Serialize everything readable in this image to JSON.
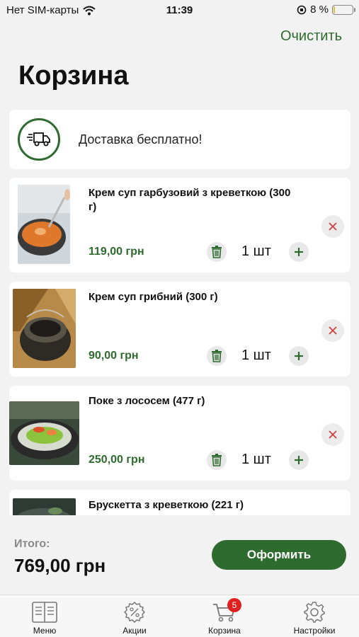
{
  "status_bar": {
    "carrier": "Нет SIM-карты",
    "time": "11:39",
    "battery": "8 %",
    "battery_level": 0.08
  },
  "header": {
    "clear_label": "Очистить",
    "title": "Корзина"
  },
  "delivery": {
    "text": "Доставка бесплатно!",
    "icon": "delivery-truck-icon"
  },
  "items": [
    {
      "name": "Крем суп гарбузовий з креветкою (300 г)",
      "price": "119,00 грн",
      "qty": "1 шт"
    },
    {
      "name": "Крем суп грибний (300 г)",
      "price": "90,00 грн",
      "qty": "1 шт"
    },
    {
      "name": "Поке з лососем (477 г)",
      "price": "250,00 грн",
      "qty": "1 шт"
    },
    {
      "name": "Брускетта з креветкою (221 г)",
      "price": "",
      "qty": ""
    }
  ],
  "footer": {
    "total_label": "Итого:",
    "total_value": "769,00 грн",
    "checkout_label": "Оформить"
  },
  "tabbar": {
    "tabs": [
      {
        "label": "Меню",
        "icon": "menu-book-icon"
      },
      {
        "label": "Акции",
        "icon": "discount-badge-icon"
      },
      {
        "label": "Корзина",
        "icon": "cart-icon",
        "badge": "5"
      },
      {
        "label": "Настройки",
        "icon": "gear-icon"
      }
    ]
  },
  "colors": {
    "accent": "#2e6b2e",
    "remove": "#d04040",
    "badge": "#e02020",
    "background": "#f2f2f2"
  }
}
